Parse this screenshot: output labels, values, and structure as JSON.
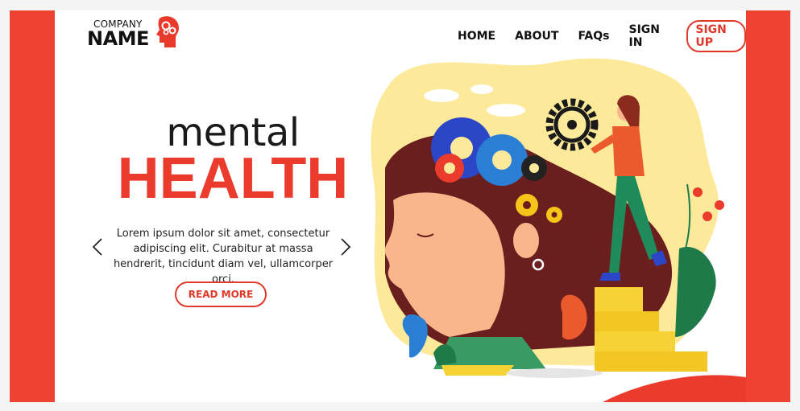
{
  "brand": {
    "company_label": "COMPANY",
    "name_label": "NAME",
    "icon": "head-gears-icon"
  },
  "nav": {
    "items": [
      "HOME",
      "ABOUT",
      "FAQs",
      "SIGN IN"
    ],
    "signup_label": "SIGN UP"
  },
  "hero": {
    "title_top": "mental",
    "title_bottom": "HEALTH",
    "body": "Lorem ipsum dolor sit amet, consectetur adipiscing elit. Curabitur at massa hendrerit, tincidunt diam vel, ullamcorper orci.",
    "read_more_label": "READ MORE"
  },
  "colors": {
    "accent": "#ea3b2c",
    "frame": "#ee4233",
    "text": "#1a1a1a",
    "blob": "#fde99a"
  }
}
